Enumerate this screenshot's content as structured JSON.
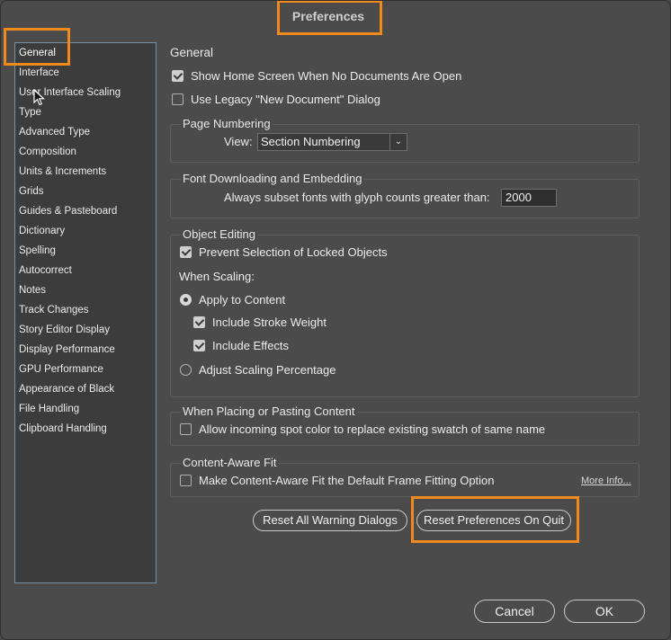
{
  "window": {
    "title": "Preferences"
  },
  "sidebar": {
    "items": [
      "General",
      "Interface",
      "User Interface Scaling",
      "Type",
      "Advanced Type",
      "Composition",
      "Units & Increments",
      "Grids",
      "Guides & Pasteboard",
      "Dictionary",
      "Spelling",
      "Autocorrect",
      "Notes",
      "Track Changes",
      "Story Editor Display",
      "Display Performance",
      "GPU Performance",
      "Appearance of Black",
      "File Handling",
      "Clipboard Handling"
    ],
    "selected": "General"
  },
  "main": {
    "heading": "General",
    "show_home_screen": {
      "label": "Show Home Screen When No Documents Are Open",
      "checked": true
    },
    "use_legacy_dialog": {
      "label": "Use Legacy \"New Document\" Dialog",
      "checked": false
    },
    "page_numbering": {
      "title": "Page Numbering",
      "view_label": "View:",
      "view_value": "Section Numbering"
    },
    "font_downloading": {
      "title": "Font Downloading and Embedding",
      "subset_label": "Always subset fonts with glyph counts greater than:",
      "subset_value": "2000"
    },
    "object_editing": {
      "title": "Object Editing",
      "prevent_selection": {
        "label": "Prevent Selection of Locked Objects",
        "checked": true
      },
      "when_scaling": "When Scaling:",
      "apply_to_content": {
        "label": "Apply to Content",
        "selected": true
      },
      "include_stroke": {
        "label": "Include Stroke Weight",
        "checked": true
      },
      "include_effects": {
        "label": "Include Effects",
        "checked": true
      },
      "adjust_scaling": {
        "label": "Adjust Scaling Percentage",
        "selected": false
      }
    },
    "placing": {
      "title": "When Placing or Pasting Content",
      "allow_spot": {
        "label": "Allow incoming spot color to replace existing swatch of same name",
        "checked": false
      }
    },
    "content_aware": {
      "title": "Content-Aware Fit",
      "make_default": {
        "label": "Make Content-Aware Fit the Default Frame Fitting Option",
        "checked": false
      },
      "more_info": "More Info..."
    },
    "reset_warnings": "Reset All Warning Dialogs",
    "reset_prefs": "Reset Preferences On Quit"
  },
  "footer": {
    "cancel": "Cancel",
    "ok": "OK"
  },
  "colors": {
    "highlight": "#f08a1c",
    "background": "#4b4b4b"
  }
}
